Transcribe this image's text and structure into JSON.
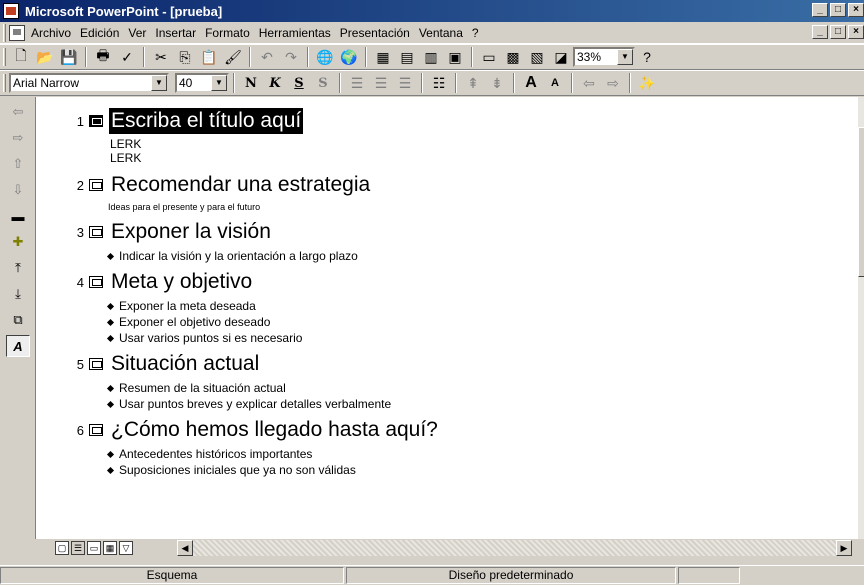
{
  "window": {
    "title": "Microsoft PowerPoint - [prueba]",
    "controls": [
      "_",
      "□",
      "×"
    ]
  },
  "menu": {
    "items": [
      "Archivo",
      "Edición",
      "Ver",
      "Insertar",
      "Formato",
      "Herramientas",
      "Presentación",
      "Ventana",
      "?"
    ]
  },
  "toolbar_standard": {
    "zoom": "33%",
    "icons": [
      "new-icon",
      "open-icon",
      "save-icon",
      "print-icon",
      "spelling-icon",
      "cut-icon",
      "copy-icon",
      "paste-icon",
      "format-painter-icon",
      "undo-icon",
      "redo-icon",
      "insert-hyperlink-icon",
      "web-toolbar-icon",
      "insert-table-icon",
      "insert-excel-icon",
      "insert-chart-icon",
      "new-slide-icon",
      "slide-layout-icon",
      "apply-design-icon",
      "grayscale-icon",
      "help-icon"
    ]
  },
  "toolbar_format": {
    "font": "Arial Narrow",
    "size": "40",
    "bold": "N",
    "italic": "K",
    "underline": "S",
    "shadow": "S"
  },
  "outline": {
    "slides": [
      {
        "num": "1",
        "title": "Escriba el título aquí",
        "selected": true,
        "sub": [
          "LERK",
          "LERK"
        ],
        "bullets": []
      },
      {
        "num": "2",
        "title": "Recomendar una estrategia",
        "selected": false,
        "small": "Ideas para el presente y para el futuro",
        "bullets": []
      },
      {
        "num": "3",
        "title": "Exponer la visión",
        "selected": false,
        "bullets": [
          "Indicar la visión y la orientación a largo plazo"
        ]
      },
      {
        "num": "4",
        "title": "Meta y objetivo",
        "selected": false,
        "bullets": [
          "Exponer la meta deseada",
          "Exponer el objetivo deseado",
          "Usar varios puntos si es necesario"
        ]
      },
      {
        "num": "5",
        "title": "Situación actual",
        "selected": false,
        "bullets": [
          "Resumen de la situación actual",
          "Usar puntos breves y explicar detalles verbalmente"
        ]
      },
      {
        "num": "6",
        "title": "¿Cómo hemos llegado hasta aquí?",
        "selected": false,
        "bullets": [
          "Antecedentes históricos importantes",
          "Suposiciones iniciales que ya no son válidas"
        ]
      }
    ]
  },
  "status": {
    "view": "Esquema",
    "design": "Diseño predeterminado"
  }
}
